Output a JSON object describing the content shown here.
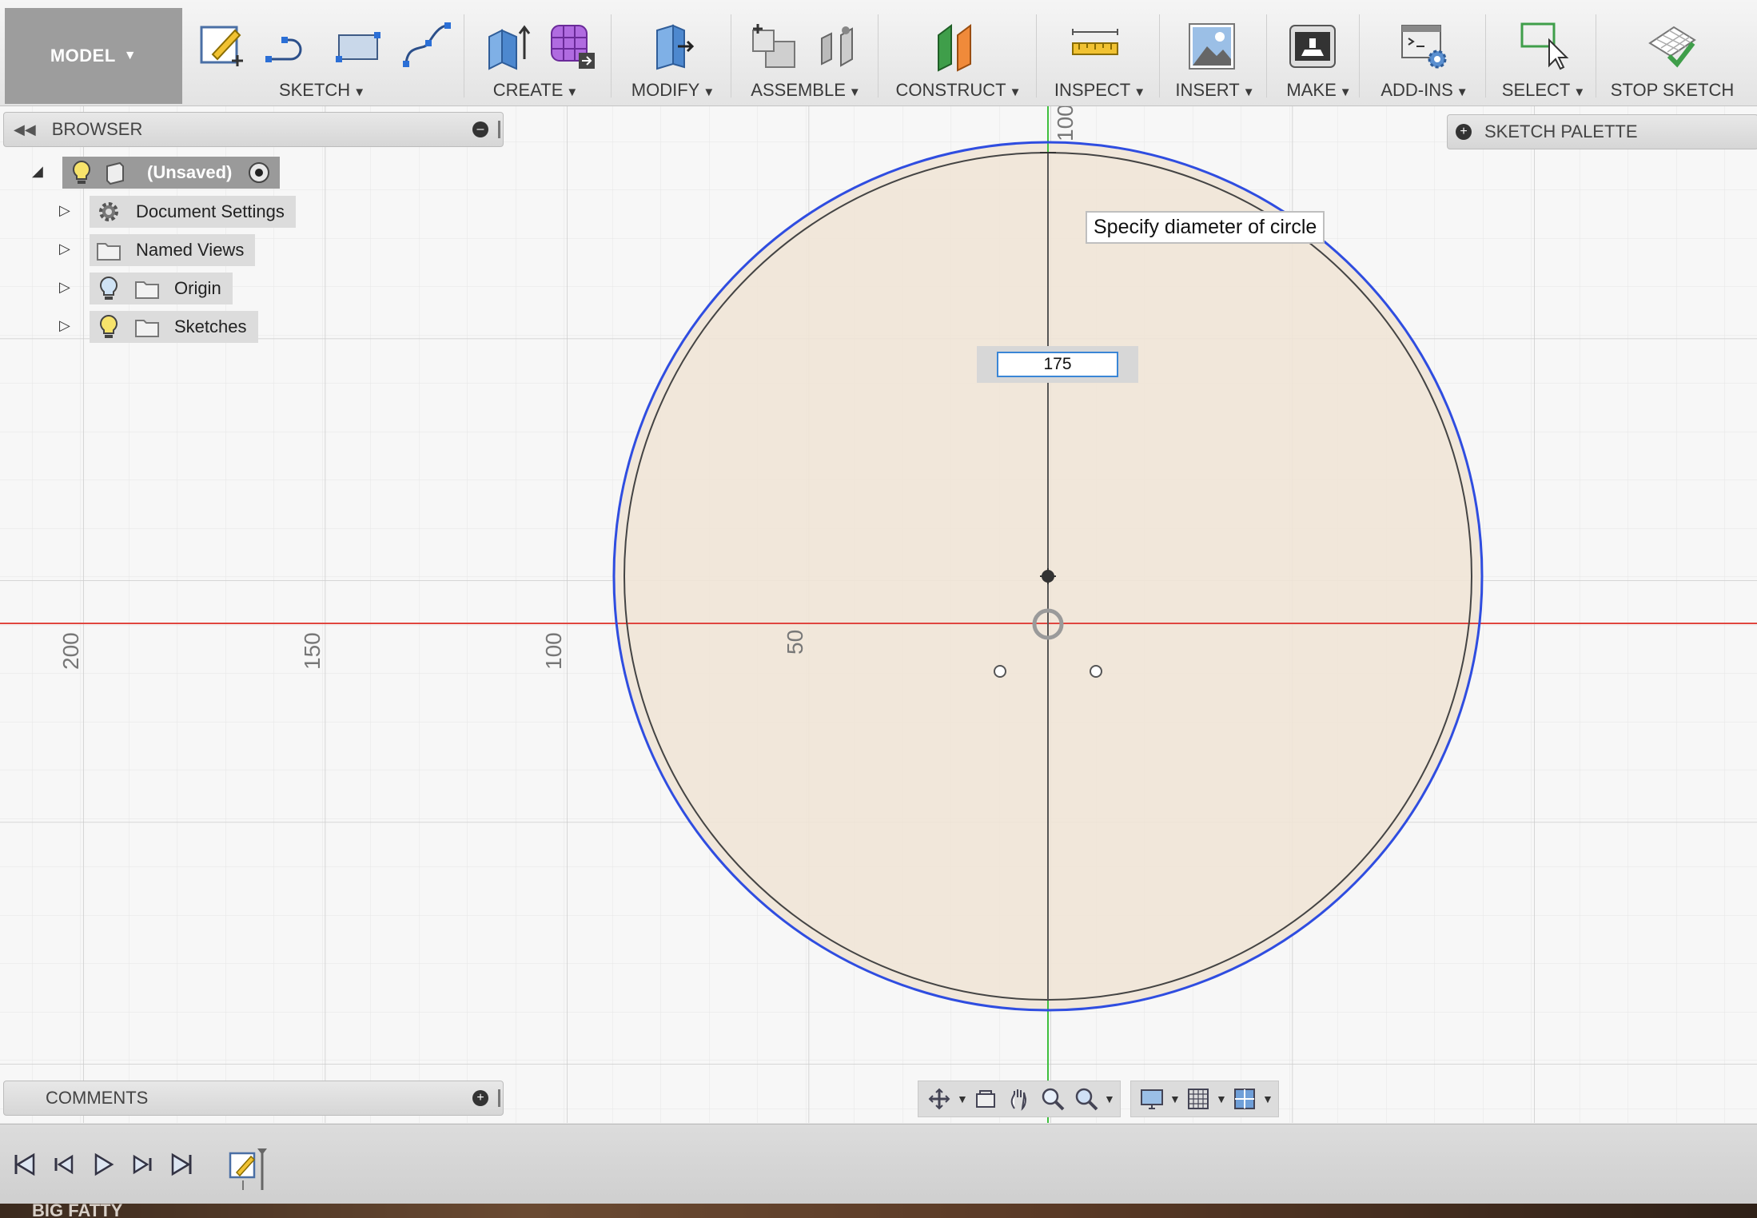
{
  "toolbar": {
    "model_label": "MODEL",
    "groups": {
      "sketch": "SKETCH",
      "create": "CREATE",
      "modify": "MODIFY",
      "assemble": "ASSEMBLE",
      "construct": "CONSTRUCT",
      "inspect": "INSPECT",
      "insert": "INSERT",
      "make": "MAKE",
      "addins": "ADD-INS",
      "select": "SELECT",
      "stop_sketch": "STOP SKETCH"
    }
  },
  "browser": {
    "title": "BROWSER",
    "root": "(Unsaved)",
    "items": [
      {
        "label": "Document Settings",
        "icon": "gear-icon"
      },
      {
        "label": "Named Views",
        "icon": "folder-icon"
      },
      {
        "label": "Origin",
        "icon": "folder-icon"
      },
      {
        "label": "Sketches",
        "icon": "folder-icon"
      }
    ]
  },
  "sketch_palette": {
    "title": "SKETCH PALETTE"
  },
  "comments": {
    "title": "COMMENTS"
  },
  "canvas": {
    "tooltip": "Specify diameter of circle",
    "diameter_value": "175",
    "ruler_h": [
      "200",
      "150",
      "100",
      "50"
    ],
    "ruler_v_top": "100",
    "colors": {
      "x_axis": "#e0463f",
      "y_axis": "#3fbf3f",
      "circle_preview": "#2f4de0",
      "circle_fill": "#efe4d6"
    }
  },
  "desktop_text": "BIG FATTY"
}
